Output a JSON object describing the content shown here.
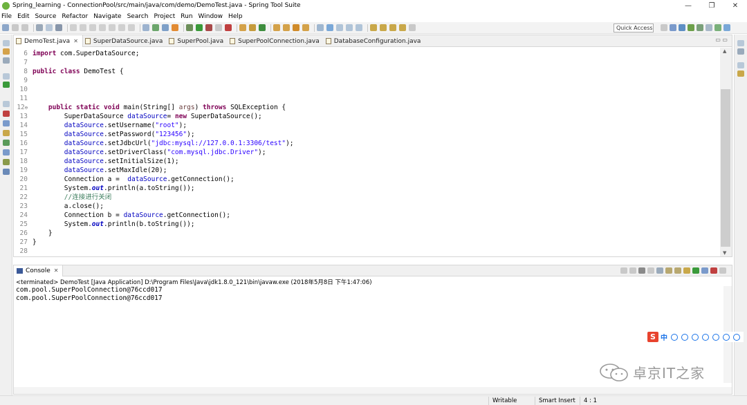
{
  "window": {
    "title": "Spring_learning - ConnectionPool/src/main/java/com/demo/DemoTest.java - Spring Tool Suite",
    "minimize": "—",
    "maximize": "❐",
    "close": "✕"
  },
  "menu": [
    "File",
    "Edit",
    "Source",
    "Refactor",
    "Navigate",
    "Search",
    "Project",
    "Run",
    "Window",
    "Help"
  ],
  "toolbar": {
    "quick_access": "Quick Access"
  },
  "editor": {
    "tabs": [
      {
        "label": "DemoTest.java",
        "active": true,
        "close": "✕"
      },
      {
        "label": "SuperDataSource.java"
      },
      {
        "label": "SuperPool.java"
      },
      {
        "label": "SuperPoolConnection.java"
      },
      {
        "label": "DatabaseConfiguration.java"
      }
    ],
    "view_controls": "▭ ▭"
  },
  "code": [
    {
      "n": "6",
      "parts": [
        [
          "kw",
          "import"
        ],
        [
          "",
          "com.SuperDataSource;"
        ]
      ]
    },
    {
      "n": "7",
      "parts": []
    },
    {
      "n": "8",
      "parts": [
        [
          "kw",
          "public"
        ],
        [
          "",
          ""
        ],
        [
          "kw",
          "class"
        ],
        [
          "",
          "DemoTest {"
        ]
      ]
    },
    {
      "n": "9",
      "parts": []
    },
    {
      "n": "10",
      "parts": []
    },
    {
      "n": "11",
      "parts": []
    },
    {
      "n": "12",
      "fold": "⊖",
      "parts": [
        [
          "",
          "    "
        ],
        [
          "kw",
          "public"
        ],
        [
          "",
          ""
        ],
        [
          "kw",
          "static"
        ],
        [
          "",
          ""
        ],
        [
          "kw",
          "void"
        ],
        [
          "",
          "main(String[] "
        ],
        [
          "param",
          "args"
        ],
        [
          "",
          ") "
        ],
        [
          "kw",
          "throws"
        ],
        [
          "",
          "SQLException {"
        ]
      ]
    },
    {
      "n": "13",
      "parts": [
        [
          "",
          "        SuperDataSource "
        ],
        [
          "var",
          "dataSource"
        ],
        [
          "",
          ""
        ],
        [
          "",
          "= "
        ],
        [
          "kw",
          "new"
        ],
        [
          "",
          "SuperDataSource();"
        ]
      ]
    },
    {
      "n": "14",
      "parts": [
        [
          "",
          "        "
        ],
        [
          "var",
          "dataSource"
        ],
        [
          "",
          ".setUsername("
        ],
        [
          "str",
          "\"root\""
        ],
        [
          "",
          ");"
        ]
      ]
    },
    {
      "n": "15",
      "parts": [
        [
          "",
          "        "
        ],
        [
          "var",
          "dataSource"
        ],
        [
          "",
          ".setPassword("
        ],
        [
          "str",
          "\"123456\""
        ],
        [
          "",
          ");"
        ]
      ]
    },
    {
      "n": "16",
      "parts": [
        [
          "",
          "        "
        ],
        [
          "var",
          "dataSource"
        ],
        [
          "",
          ".setJdbcUrl("
        ],
        [
          "str",
          "\"jdbc:mysql://127.0.0.1:3306/test\""
        ],
        [
          "",
          ");"
        ]
      ]
    },
    {
      "n": "17",
      "parts": [
        [
          "",
          "        "
        ],
        [
          "var",
          "dataSource"
        ],
        [
          "",
          ".setDriverClass("
        ],
        [
          "str",
          "\"com.mysql.jdbc.Driver\""
        ],
        [
          "",
          ");"
        ]
      ]
    },
    {
      "n": "18",
      "parts": [
        [
          "",
          "        "
        ],
        [
          "var",
          "dataSource"
        ],
        [
          "",
          ".setInitialSize(1);"
        ]
      ]
    },
    {
      "n": "19",
      "parts": [
        [
          "",
          "        "
        ],
        [
          "var",
          "dataSource"
        ],
        [
          "",
          ".setMaxIdle(20);"
        ]
      ]
    },
    {
      "n": "20",
      "parts": [
        [
          "",
          "        Connection a =  "
        ],
        [
          "var",
          "dataSource"
        ],
        [
          "",
          ".getConnection();"
        ]
      ]
    },
    {
      "n": "21",
      "parts": [
        [
          "",
          "        System."
        ],
        [
          "static-f",
          "out"
        ],
        [
          "",
          ".println(a.toString());"
        ]
      ]
    },
    {
      "n": "22",
      "parts": [
        [
          "",
          "        "
        ],
        [
          "cmt",
          "//连接进行关闭"
        ]
      ]
    },
    {
      "n": "23",
      "parts": [
        [
          "",
          "        a.close();"
        ]
      ]
    },
    {
      "n": "24",
      "parts": [
        [
          "",
          "        Connection b = "
        ],
        [
          "var",
          "dataSource"
        ],
        [
          "",
          ".getConnection();"
        ]
      ]
    },
    {
      "n": "25",
      "parts": [
        [
          "",
          "        System."
        ],
        [
          "static-f",
          "out"
        ],
        [
          "",
          ".println(b.toString());"
        ]
      ]
    },
    {
      "n": "26",
      "parts": [
        [
          "",
          "    }"
        ]
      ]
    },
    {
      "n": "27",
      "parts": [
        [
          "",
          "}"
        ]
      ]
    },
    {
      "n": "28",
      "parts": []
    }
  ],
  "console": {
    "tab": "Console",
    "close": "✕",
    "terminated": "<terminated> DemoTest [Java Application] D:\\Program Files\\Java\\jdk1.8.0_121\\bin\\javaw.exe (2018年5月8日 下午1:47:06)",
    "lines": [
      "com.pool.SuperPoolConnection@76ccd017",
      "com.pool.SuperPoolConnection@76ccd017"
    ]
  },
  "status": {
    "writable": "Writable",
    "insert_mode": "Smart Insert",
    "position": "4 : 1"
  },
  "ime": {
    "logo": "S",
    "lang": "中"
  },
  "watermark": {
    "text": "卓京IT之家"
  },
  "colors": {
    "keyword": "#7f0055",
    "field": "#0000c0",
    "string": "#2a00ff",
    "comment": "#3f7f5f"
  }
}
